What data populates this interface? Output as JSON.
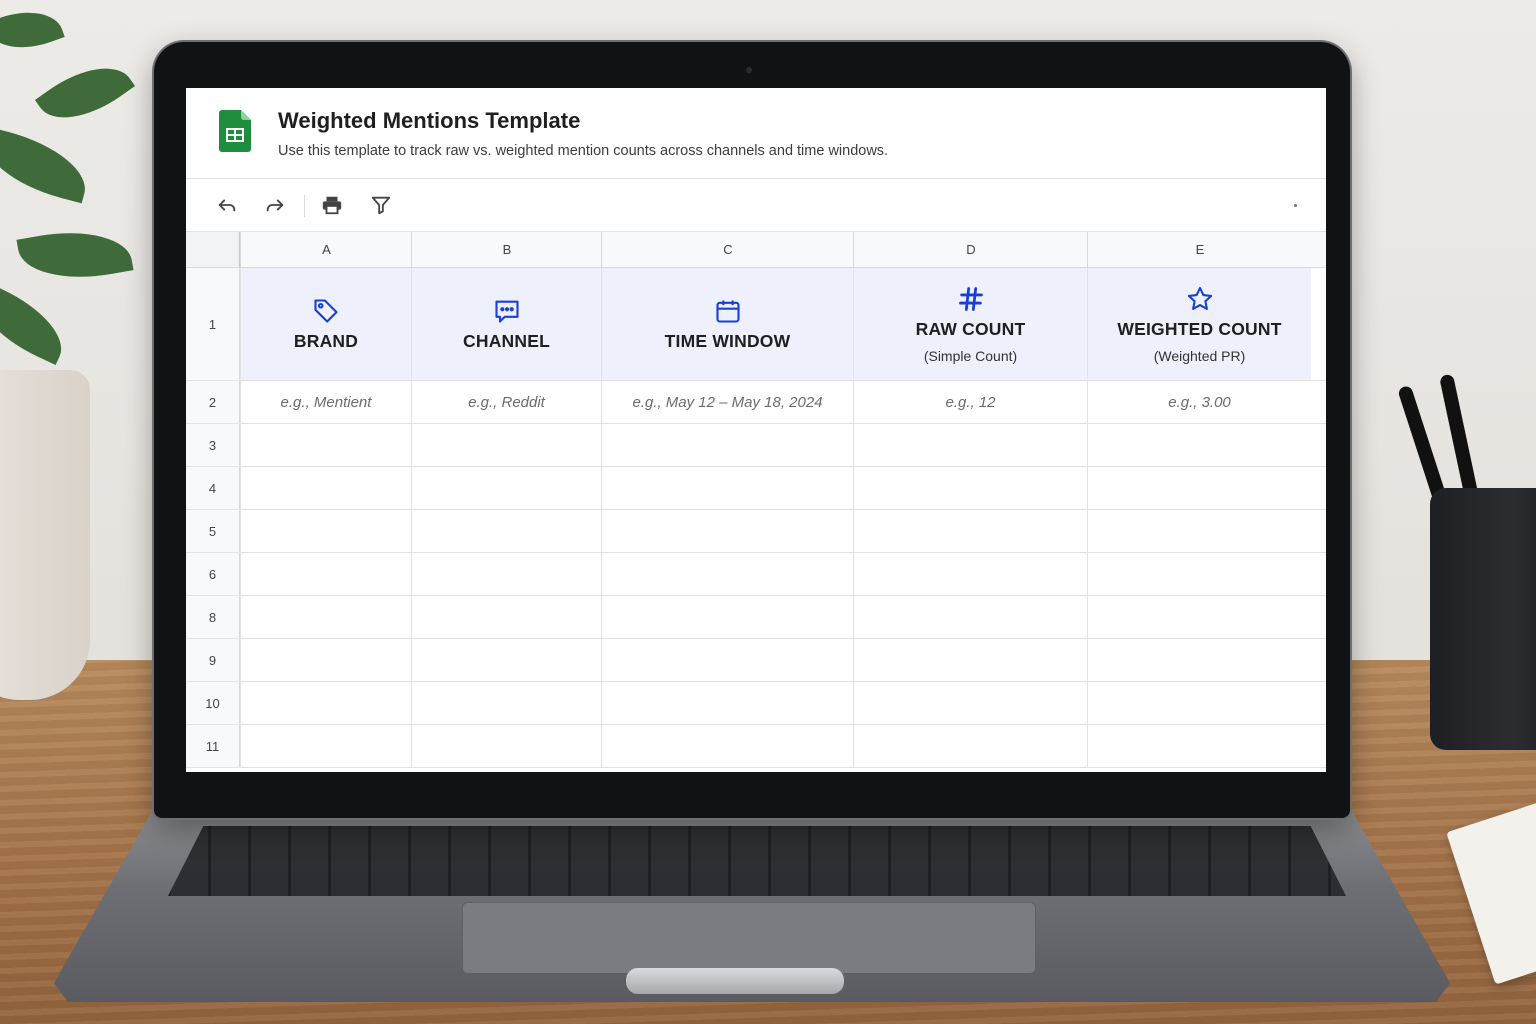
{
  "document": {
    "title": "Weighted Mentions Template",
    "subtitle": "Use this template to track raw vs. weighted mention counts across channels and time windows."
  },
  "toolbar": {
    "buttons": [
      {
        "name": "undo-icon"
      },
      {
        "name": "redo-icon"
      },
      {
        "name": "print-icon"
      },
      {
        "name": "filter-icon"
      }
    ]
  },
  "grid": {
    "columns": [
      "A",
      "B",
      "C",
      "D",
      "E"
    ],
    "header_row_number": "1",
    "headers": [
      {
        "icon": "tag-icon",
        "label": "BRAND",
        "sub": ""
      },
      {
        "icon": "chat-icon",
        "label": "CHANNEL",
        "sub": ""
      },
      {
        "icon": "calendar-icon",
        "label": "TIME WINDOW",
        "sub": ""
      },
      {
        "icon": "hash-icon",
        "label": "RAW COUNT",
        "sub": "(Simple Count)"
      },
      {
        "icon": "star-icon",
        "label": "WEIGHTED COUNT",
        "sub": "(Weighted PR)"
      }
    ],
    "example_row_number": "2",
    "examples": [
      "e.g., Mentient",
      "e.g., Reddit",
      "e.g., May 12 – May 18, 2024",
      "e.g., 12",
      "e.g., 3.00"
    ],
    "empty_row_numbers": [
      "3",
      "4",
      "5",
      "6",
      "8",
      "9",
      "10",
      "11"
    ]
  },
  "colors": {
    "accent_icon": "#1a3fd6",
    "header_fill": "#eef0fb",
    "sheets_green": "#1e8e3e"
  }
}
